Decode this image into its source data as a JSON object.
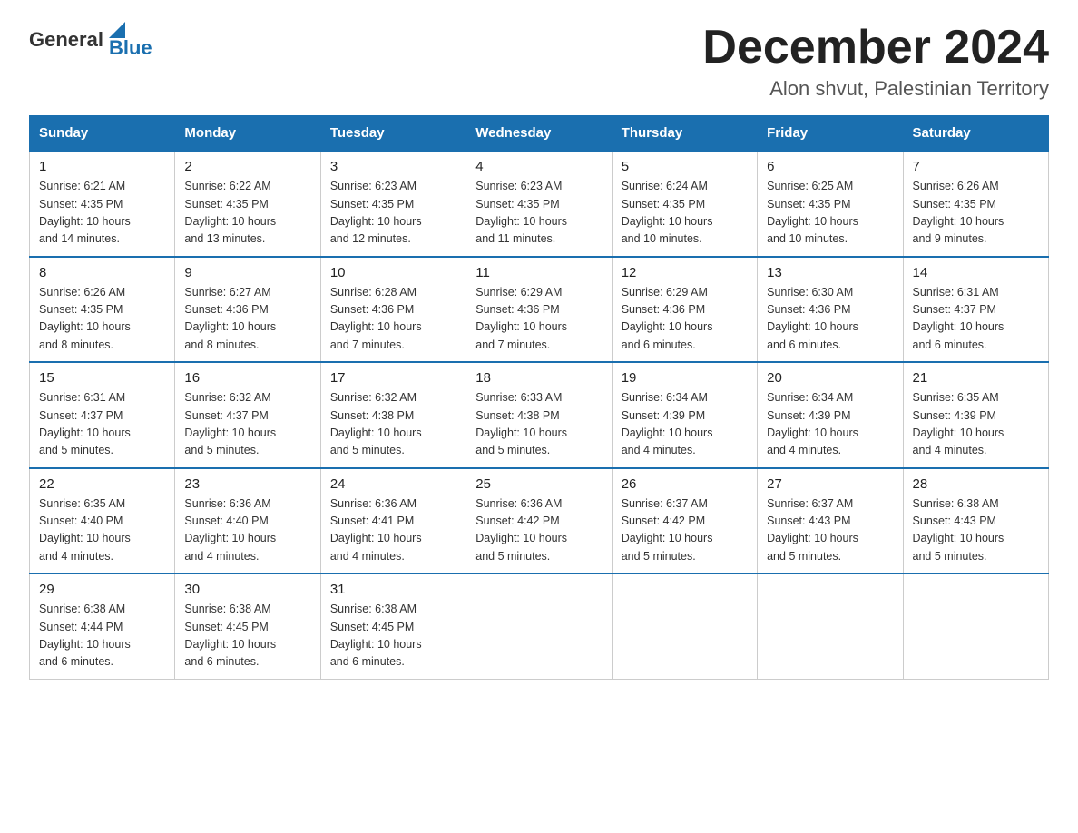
{
  "logo": {
    "text_general": "General",
    "text_blue": "Blue"
  },
  "title": {
    "month_year": "December 2024",
    "location": "Alon shvut, Palestinian Territory"
  },
  "weekdays": [
    "Sunday",
    "Monday",
    "Tuesday",
    "Wednesday",
    "Thursday",
    "Friday",
    "Saturday"
  ],
  "weeks": [
    [
      {
        "day": "1",
        "sunrise": "6:21 AM",
        "sunset": "4:35 PM",
        "daylight": "10 hours and 14 minutes."
      },
      {
        "day": "2",
        "sunrise": "6:22 AM",
        "sunset": "4:35 PM",
        "daylight": "10 hours and 13 minutes."
      },
      {
        "day": "3",
        "sunrise": "6:23 AM",
        "sunset": "4:35 PM",
        "daylight": "10 hours and 12 minutes."
      },
      {
        "day": "4",
        "sunrise": "6:23 AM",
        "sunset": "4:35 PM",
        "daylight": "10 hours and 11 minutes."
      },
      {
        "day": "5",
        "sunrise": "6:24 AM",
        "sunset": "4:35 PM",
        "daylight": "10 hours and 10 minutes."
      },
      {
        "day": "6",
        "sunrise": "6:25 AM",
        "sunset": "4:35 PM",
        "daylight": "10 hours and 10 minutes."
      },
      {
        "day": "7",
        "sunrise": "6:26 AM",
        "sunset": "4:35 PM",
        "daylight": "10 hours and 9 minutes."
      }
    ],
    [
      {
        "day": "8",
        "sunrise": "6:26 AM",
        "sunset": "4:35 PM",
        "daylight": "10 hours and 8 minutes."
      },
      {
        "day": "9",
        "sunrise": "6:27 AM",
        "sunset": "4:36 PM",
        "daylight": "10 hours and 8 minutes."
      },
      {
        "day": "10",
        "sunrise": "6:28 AM",
        "sunset": "4:36 PM",
        "daylight": "10 hours and 7 minutes."
      },
      {
        "day": "11",
        "sunrise": "6:29 AM",
        "sunset": "4:36 PM",
        "daylight": "10 hours and 7 minutes."
      },
      {
        "day": "12",
        "sunrise": "6:29 AM",
        "sunset": "4:36 PM",
        "daylight": "10 hours and 6 minutes."
      },
      {
        "day": "13",
        "sunrise": "6:30 AM",
        "sunset": "4:36 PM",
        "daylight": "10 hours and 6 minutes."
      },
      {
        "day": "14",
        "sunrise": "6:31 AM",
        "sunset": "4:37 PM",
        "daylight": "10 hours and 6 minutes."
      }
    ],
    [
      {
        "day": "15",
        "sunrise": "6:31 AM",
        "sunset": "4:37 PM",
        "daylight": "10 hours and 5 minutes."
      },
      {
        "day": "16",
        "sunrise": "6:32 AM",
        "sunset": "4:37 PM",
        "daylight": "10 hours and 5 minutes."
      },
      {
        "day": "17",
        "sunrise": "6:32 AM",
        "sunset": "4:38 PM",
        "daylight": "10 hours and 5 minutes."
      },
      {
        "day": "18",
        "sunrise": "6:33 AM",
        "sunset": "4:38 PM",
        "daylight": "10 hours and 5 minutes."
      },
      {
        "day": "19",
        "sunrise": "6:34 AM",
        "sunset": "4:39 PM",
        "daylight": "10 hours and 4 minutes."
      },
      {
        "day": "20",
        "sunrise": "6:34 AM",
        "sunset": "4:39 PM",
        "daylight": "10 hours and 4 minutes."
      },
      {
        "day": "21",
        "sunrise": "6:35 AM",
        "sunset": "4:39 PM",
        "daylight": "10 hours and 4 minutes."
      }
    ],
    [
      {
        "day": "22",
        "sunrise": "6:35 AM",
        "sunset": "4:40 PM",
        "daylight": "10 hours and 4 minutes."
      },
      {
        "day": "23",
        "sunrise": "6:36 AM",
        "sunset": "4:40 PM",
        "daylight": "10 hours and 4 minutes."
      },
      {
        "day": "24",
        "sunrise": "6:36 AM",
        "sunset": "4:41 PM",
        "daylight": "10 hours and 4 minutes."
      },
      {
        "day": "25",
        "sunrise": "6:36 AM",
        "sunset": "4:42 PM",
        "daylight": "10 hours and 5 minutes."
      },
      {
        "day": "26",
        "sunrise": "6:37 AM",
        "sunset": "4:42 PM",
        "daylight": "10 hours and 5 minutes."
      },
      {
        "day": "27",
        "sunrise": "6:37 AM",
        "sunset": "4:43 PM",
        "daylight": "10 hours and 5 minutes."
      },
      {
        "day": "28",
        "sunrise": "6:38 AM",
        "sunset": "4:43 PM",
        "daylight": "10 hours and 5 minutes."
      }
    ],
    [
      {
        "day": "29",
        "sunrise": "6:38 AM",
        "sunset": "4:44 PM",
        "daylight": "10 hours and 6 minutes."
      },
      {
        "day": "30",
        "sunrise": "6:38 AM",
        "sunset": "4:45 PM",
        "daylight": "10 hours and 6 minutes."
      },
      {
        "day": "31",
        "sunrise": "6:38 AM",
        "sunset": "4:45 PM",
        "daylight": "10 hours and 6 minutes."
      },
      null,
      null,
      null,
      null
    ]
  ]
}
